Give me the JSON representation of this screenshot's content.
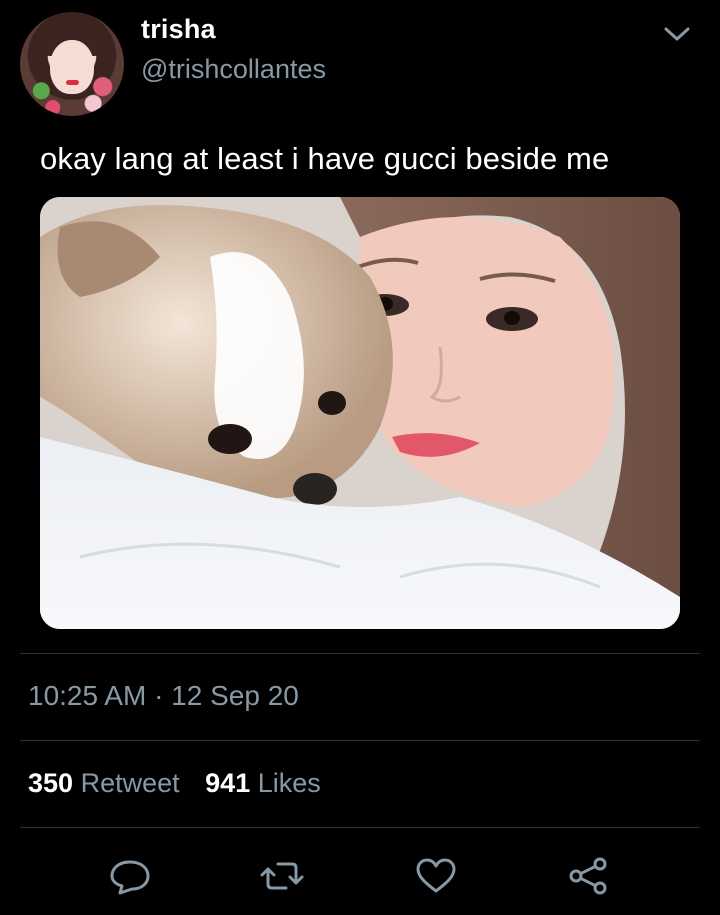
{
  "user": {
    "display_name": "trisha",
    "handle": "@trishcollantes",
    "avatar_icon": "profile-photo"
  },
  "tweet": {
    "text": "okay lang at least i have gucci beside me",
    "timestamp": "10:25 AM · 12 Sep 20"
  },
  "stats": {
    "retweets_count": "350",
    "retweets_label": "Retweet",
    "likes_count": "941",
    "likes_label": "Likes"
  },
  "actions": [
    {
      "name": "reply",
      "icon": "speech-bubble-icon"
    },
    {
      "name": "retweet",
      "icon": "retweet-arrows-icon"
    },
    {
      "name": "like",
      "icon": "heart-icon"
    },
    {
      "name": "share",
      "icon": "share-nodes-icon"
    }
  ],
  "colors": {
    "background": "#000000",
    "primary_text": "#ffffff",
    "secondary_text": "#8899a6",
    "divider": "#2f3336"
  }
}
